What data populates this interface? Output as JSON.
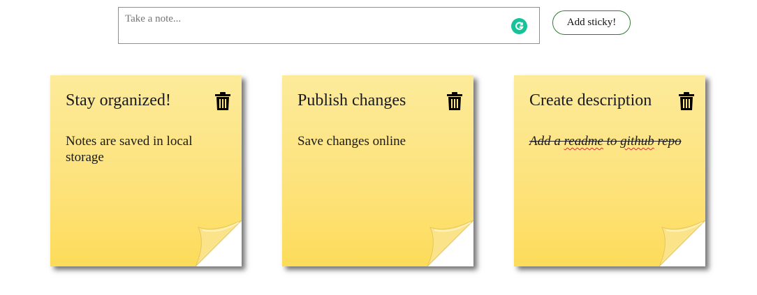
{
  "composer": {
    "placeholder": "Take a note...",
    "value": "",
    "add_label": "Add sticky!"
  },
  "notes": [
    {
      "title": "Stay organized!",
      "body": "Notes are saved in local storage",
      "completed": false
    },
    {
      "title": "Publish changes",
      "body": "Save changes online",
      "completed": false
    },
    {
      "title": "Create description",
      "body_parts": [
        "Add a ",
        "readme",
        " to ",
        "github",
        " repo"
      ],
      "completed": true
    }
  ],
  "colors": {
    "sticky_top": "#fdeb9b",
    "sticky_bottom": "#fddc5a",
    "button_border": "#2e7d32",
    "grammarly": "#15c39a",
    "spellcheck": "#d32f2f"
  },
  "icons": {
    "delete": "trash-icon",
    "assistant": "grammarly-icon",
    "corner": "page-curl-icon"
  }
}
